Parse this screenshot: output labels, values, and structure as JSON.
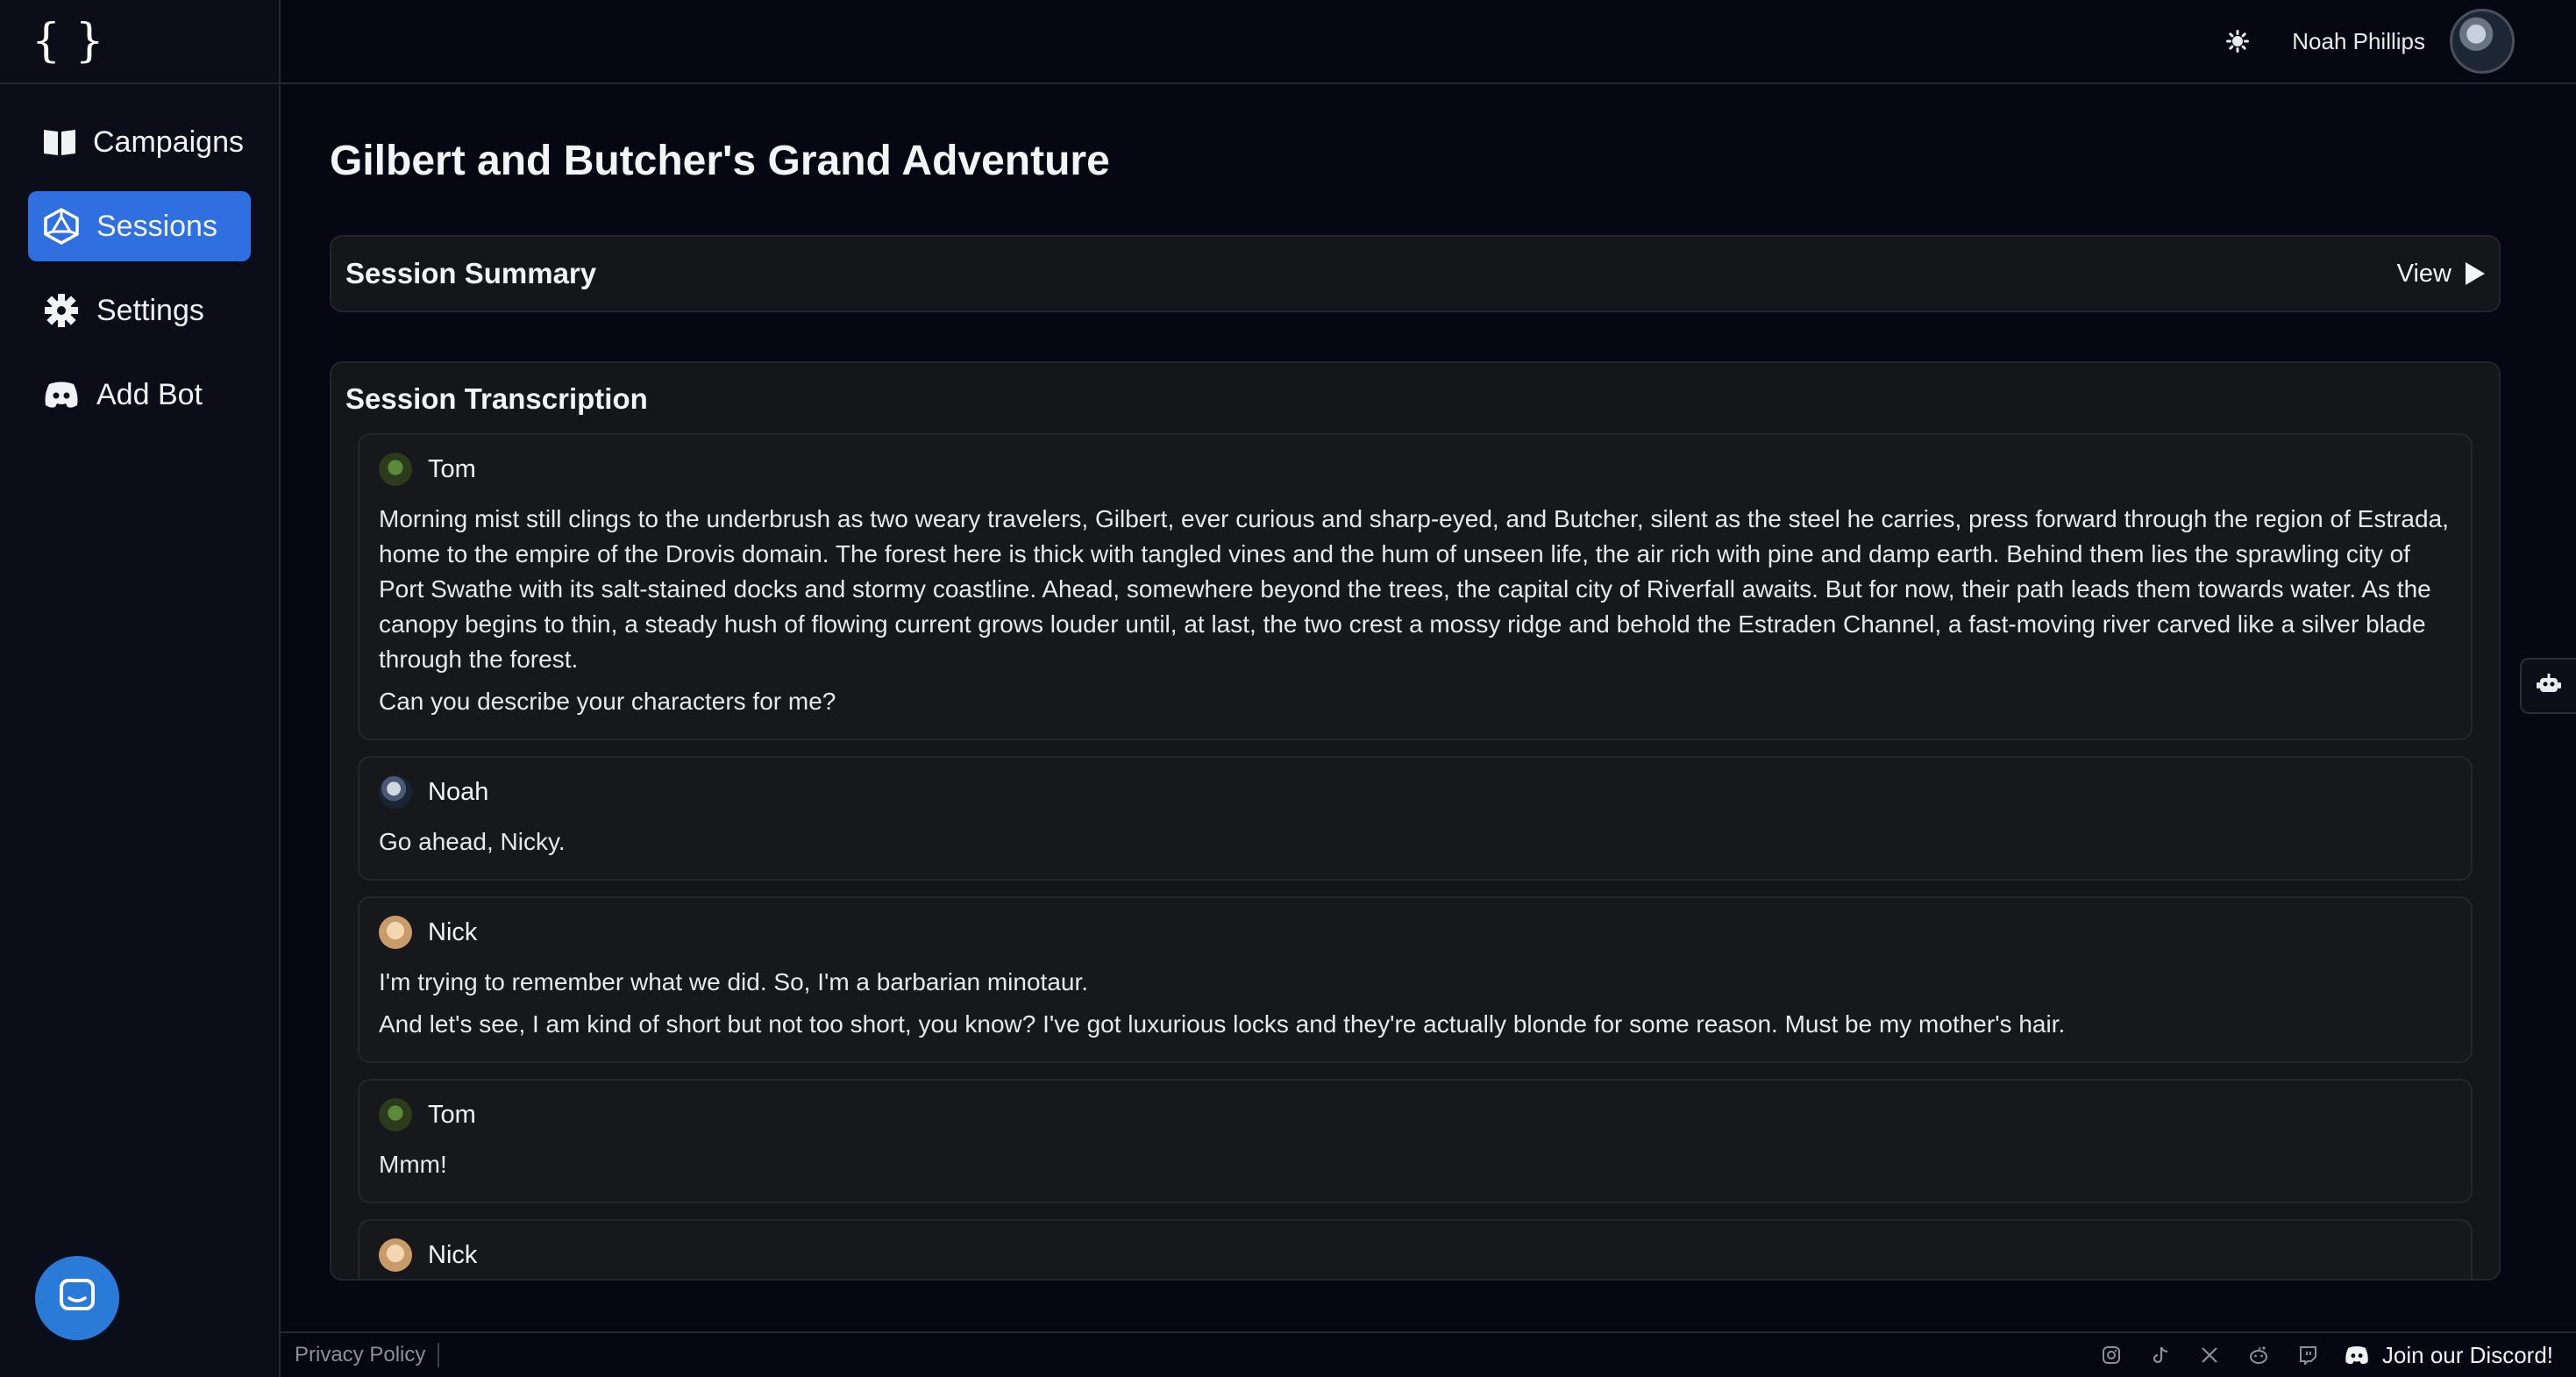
{
  "app": {
    "logo_text": "{ }"
  },
  "sidebar": {
    "items": [
      {
        "label": "Campaigns",
        "icon": "book-icon"
      },
      {
        "label": "Sessions",
        "icon": "d20-icon",
        "active": true
      },
      {
        "label": "Settings",
        "icon": "gear-icon"
      },
      {
        "label": "Add Bot",
        "icon": "discord-icon"
      }
    ]
  },
  "header": {
    "user_name": "Noah Phillips"
  },
  "page": {
    "title": "Gilbert and Butcher's Grand Adventure"
  },
  "summary": {
    "title": "Session Summary",
    "view_label": "View"
  },
  "transcription": {
    "title": "Session Transcription",
    "messages": [
      {
        "speaker": "Tom",
        "lines": [
          "Morning mist still clings to the underbrush as two weary travelers, Gilbert, ever curious and sharp-eyed, and Butcher, silent as the steel he carries, press forward through the region of Estrada, home to the empire of the Drovis domain. The forest here is thick with tangled vines and the hum of unseen life, the air rich with pine and damp earth. Behind them lies the sprawling city of Port Swathe with its salt-stained docks and stormy coastline. Ahead, somewhere beyond the trees, the capital city of Riverfall awaits. But for now, their path leads them towards water. As the canopy begins to thin, a steady hush of flowing current grows louder until, at last, the two crest a mossy ridge and behold the Estraden Channel, a fast-moving river carved like a silver blade through the forest.",
          "Can you describe your characters for me?"
        ]
      },
      {
        "speaker": "Noah",
        "lines": [
          "Go ahead, Nicky."
        ]
      },
      {
        "speaker": "Nick",
        "lines": [
          "I'm trying to remember what we did. So, I'm a barbarian minotaur.",
          "And let's see, I am kind of short but not too short, you know? I've got luxurious locks and they're actually blonde for some reason. Must be my mother's hair."
        ]
      },
      {
        "speaker": "Tom",
        "lines": [
          "Mmm!"
        ]
      },
      {
        "speaker": "Nick",
        "lines": [
          ""
        ]
      }
    ]
  },
  "footer": {
    "privacy_label": "Privacy Policy",
    "social_icons": [
      "instagram-icon",
      "tiktok-icon",
      "x-icon",
      "reddit-icon",
      "twitch-icon"
    ],
    "discord_label": "Join our Discord!"
  },
  "colors": {
    "accent": "#2f6fe0",
    "background": "#050812",
    "card": "#151619"
  }
}
